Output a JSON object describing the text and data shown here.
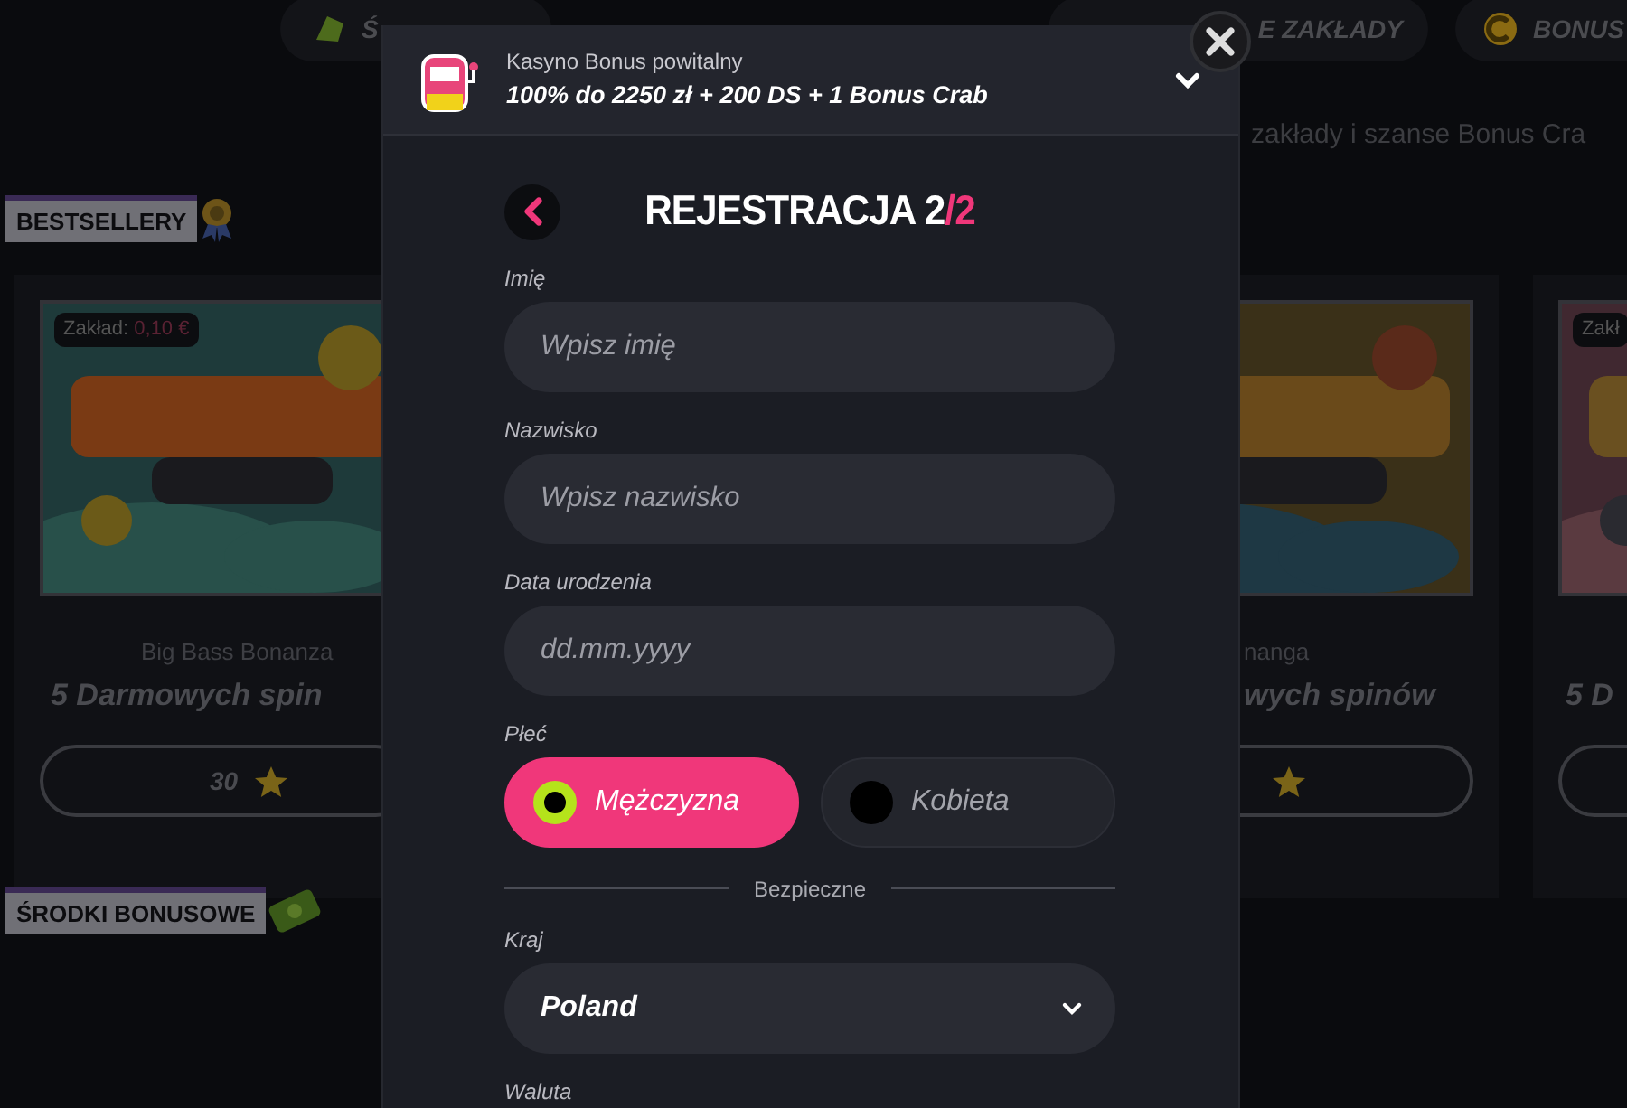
{
  "background": {
    "nav_tabs": [
      {
        "label": "Ś"
      },
      {
        "label": "E ZAKŁADY"
      },
      {
        "label": "BONUS"
      }
    ],
    "subtitle": "zakłady i szanse Bonus Cra",
    "section_title": "BESTSELLERY",
    "games": [
      {
        "bet_label": "Zakład:",
        "bet_value": "0,10 €",
        "name": "Big Bass Bonanza",
        "offer": "5 Darmowych spin",
        "price": "30"
      },
      {
        "name": "nanga",
        "offer": "wych spinów"
      },
      {
        "bet_label": "Zakł",
        "offer": "5 D"
      }
    ],
    "section_2_title": "ŚRODKI BONUSOWE"
  },
  "modal": {
    "bonus_banner": {
      "label": "Kasyno Bonus powitalny",
      "offer": "100% do 2250 zł + 200 DS + 1 Bonus Crab",
      "expanded": false
    },
    "title": "REJESTRACJA 2",
    "title_highlight": "/2",
    "fields": [
      {
        "kind": "text",
        "label": "Imię",
        "placeholder": "Wpisz imię"
      },
      {
        "kind": "text",
        "label": "Nazwisko",
        "placeholder": "Wpisz nazwisko"
      },
      {
        "kind": "text",
        "label": "Data urodzenia",
        "placeholder": "dd.mm.yyyy"
      },
      {
        "kind": "radio",
        "label": "Płeć",
        "options": [
          {
            "label": "Mężczyzna",
            "selected": true
          },
          {
            "label": "Kobieta",
            "selected": false
          }
        ]
      },
      {
        "kind": "divider",
        "label": "Bezpieczne"
      },
      {
        "kind": "select",
        "label": "Kraj",
        "value": "Poland"
      },
      {
        "kind": "label",
        "label": "Waluta"
      }
    ]
  }
}
